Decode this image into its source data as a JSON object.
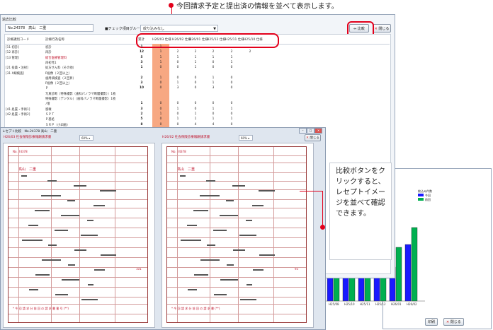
{
  "top_callout": "今回請求予定と提出済の情報を並べて表示します。",
  "right_callout": "比較ボタンをクリックすると、レセプトイメージを並べて確認できます。",
  "main_window": {
    "title": "過去比較",
    "patient": "No.24378　高山　二重",
    "group_label": "■チェック項目グループ",
    "group_value": "絞り込みなし",
    "compare_label": "比較",
    "close_label": "閉じる",
    "columns": [
      "診療識別コード",
      "診療行為名称",
      "累計",
      "H26/03 仕様",
      "H26/02 仕様",
      "H26/01 仕様",
      "H25/12 仕様",
      "H25/11 仕様",
      "H25/10 仕様"
    ],
    "rows": [
      {
        "code": "[11 初診]",
        "name": "初診",
        "vals": [
          "1",
          "1",
          "",
          "",
          "",
          "",
          ""
        ]
      },
      {
        "code": "[12 再診]",
        "name": "再診",
        "vals": [
          "12",
          "1",
          "2",
          "2",
          "2",
          "2",
          "2"
        ]
      },
      {
        "code": "[13 管理]",
        "name": "総合医療管理料",
        "vals": [
          "5",
          "1",
          "1",
          "1",
          "1",
          "1",
          ""
        ]
      },
      {
        "code": "",
        "name": "再初見1",
        "vals": [
          "3",
          "1",
          "0",
          "1",
          "0",
          "1",
          ""
        ]
      },
      {
        "code": "[21 投薬・注射]",
        "name": "処方せん料（その他）",
        "vals": [
          "1",
          "0",
          "0",
          "1",
          "0",
          "0",
          ""
        ]
      },
      {
        "code": "[31 X線検査]",
        "name": "P画像（２回以上）",
        "vals": [
          "",
          "",
          "",
          "",
          "",
          "",
          ""
        ]
      },
      {
        "code": "",
        "name": "歯周病検査（２回目）",
        "vals": [
          "2",
          "1",
          "0",
          "0",
          "1",
          "0",
          ""
        ]
      },
      {
        "code": "",
        "name": "P画像（２回以上）",
        "vals": [
          "3",
          "0",
          "1",
          "0",
          "1",
          "0",
          ""
        ]
      },
      {
        "code": "",
        "name": "Ｐ",
        "vals": [
          "10",
          "0",
          "3",
          "0",
          "3",
          "0",
          ""
        ]
      },
      {
        "code": "",
        "name": "写真診断（特殊撮影（歯科パノラマ断層撮影））1枚",
        "vals": [
          "",
          "",
          "",
          "",
          "",
          "",
          ""
        ]
      },
      {
        "code": "",
        "name": "特殊撮影（デジタル）（歯科パノラマ断層撮影）1枚",
        "vals": [
          "",
          "",
          "",
          "",
          "",
          "",
          ""
        ]
      },
      {
        "code": "",
        "name": "ﾉ増",
        "vals": [
          "1",
          "0",
          "0",
          "0",
          "0",
          "0",
          ""
        ]
      },
      {
        "code": "[41 処置・手術1]",
        "name": "感壊",
        "vals": [
          "3",
          "0",
          "1",
          "0",
          "1",
          "1",
          ""
        ]
      },
      {
        "code": "[42 処置・手術2]",
        "name": "ＳＰＴ",
        "vals": [
          "2",
          "1",
          "0",
          "1",
          "0",
          "0",
          ""
        ]
      },
      {
        "code": "",
        "name": "Ｐ基処",
        "vals": [
          "5",
          "0",
          "1",
          "1",
          "1",
          "1",
          ""
        ]
      },
      {
        "code": "",
        "name": "ＳＲＰ（小臼歯）",
        "vals": [
          "8",
          "0",
          "0",
          "4",
          "4",
          "0",
          ""
        ]
      }
    ]
  },
  "receipt_window": {
    "title": "レセプト比較　No.24378 高山　二重",
    "left_pane_label": "H26/03 社会保険診療報酬請求書",
    "right_pane_label": "H26/02 社会保険診療報酬請求書",
    "zoom": "60%",
    "close_label": "閉じる",
    "sheets": [
      {
        "no": "No. 24378",
        "name": "高山　二重",
        "footer": "* 今 回 請 求 分 前 回 の 請 求 書 番 号 (**)",
        "total": "101"
      },
      {
        "no": "No. 24378",
        "name": "高山　二重",
        "footer": "* 今 回 請 求 分 前 回 の 請 求 書 (**)",
        "total": "93"
      }
    ]
  },
  "chart_window": {
    "legend_title": "絞込み件数",
    "legend_items": [
      "今回",
      "前回"
    ],
    "x_labels": [
      "H25/08",
      "H25/10",
      "H25/11",
      "H25/12",
      "H26/01",
      "H26/02"
    ],
    "close_label": "閉じる",
    "print_label": "印刷"
  },
  "chart_data": {
    "type": "bar",
    "categories": [
      "H25/08",
      "H25/10",
      "H25/11",
      "H25/12",
      "H26/01",
      "H26/02"
    ],
    "series": [
      {
        "name": "今回",
        "values": [
          20,
          22,
          22,
          22,
          24,
          40
        ]
      },
      {
        "name": "前回",
        "values": [
          22,
          22,
          22,
          23,
          38,
          52
        ]
      }
    ],
    "colors": {
      "series1": "#1a1aff",
      "series2": "#00b050"
    },
    "legend": "top-right"
  }
}
